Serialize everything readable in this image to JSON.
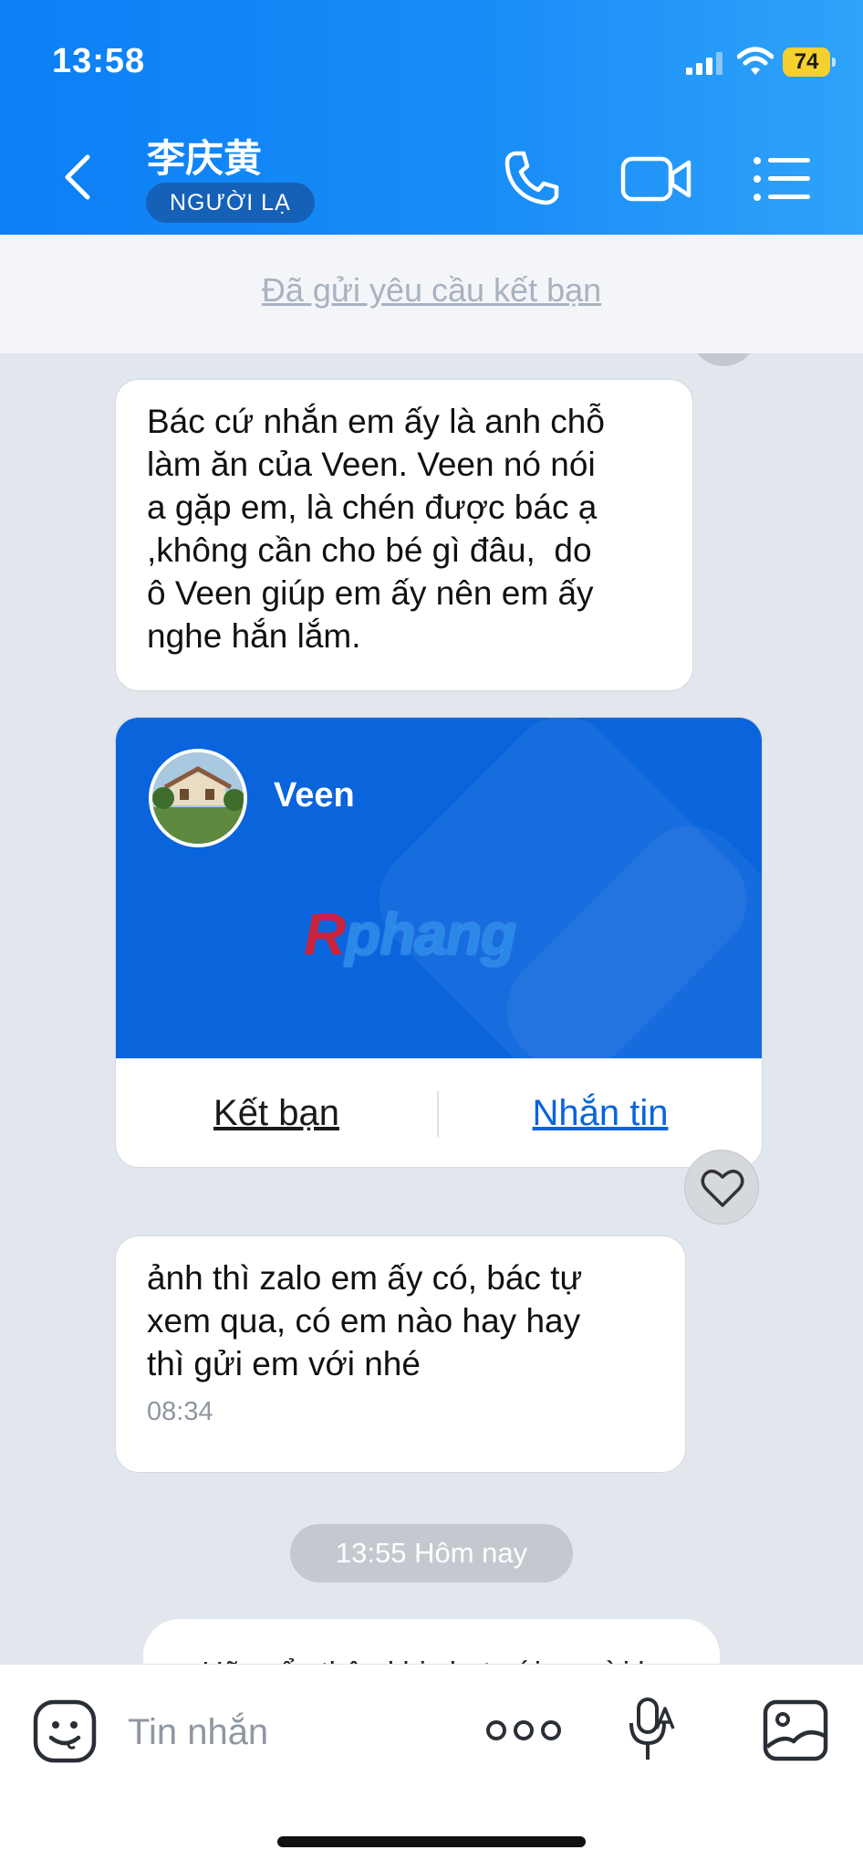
{
  "status_bar": {
    "time": "13:58",
    "battery": "74"
  },
  "header": {
    "contact_name": "李庆黄",
    "badge": "NGƯỜI LẠ",
    "back_icon": "chevron-left-icon",
    "call_icon": "phone-icon",
    "video_icon": "video-camera-icon",
    "menu_icon": "list-menu-icon"
  },
  "friend_request": {
    "text": "Đã gửi yêu cầu kết bạn"
  },
  "messages": {
    "m1_lines": [
      "Bác cứ nhắn em ấy là anh chỗ",
      "làm ăn của Veen. Veen nó nói",
      "a gặp em, là chén được bác ạ",
      ",không cần cho bé gì đâu,  do",
      "ô Veen giúp em ấy nên em ấy",
      "nghe hắn lắm."
    ],
    "card": {
      "name": "Veen",
      "watermark_r": "R",
      "watermark_rest": "phang",
      "add_friend": "Kết bạn",
      "send_message": "Nhắn tin",
      "accent": "#0a64dc"
    },
    "m2_lines": [
      "ảnh thì zalo em ấy có, bác tự",
      "xem qua, có em nào hay hay",
      "thì gửi em với nhé"
    ],
    "m2_time": "08:34",
    "date_divider": "13:55 Hôm nay",
    "warning": "Hãy cẩn thận khi chat với người lạ"
  },
  "input_bar": {
    "placeholder": "Tin nhắn",
    "sticker_icon": "sticker-face-icon",
    "more_icon": "more-dots-icon",
    "voice_icon": "voice-to-text-icon",
    "image_icon": "image-icon"
  }
}
